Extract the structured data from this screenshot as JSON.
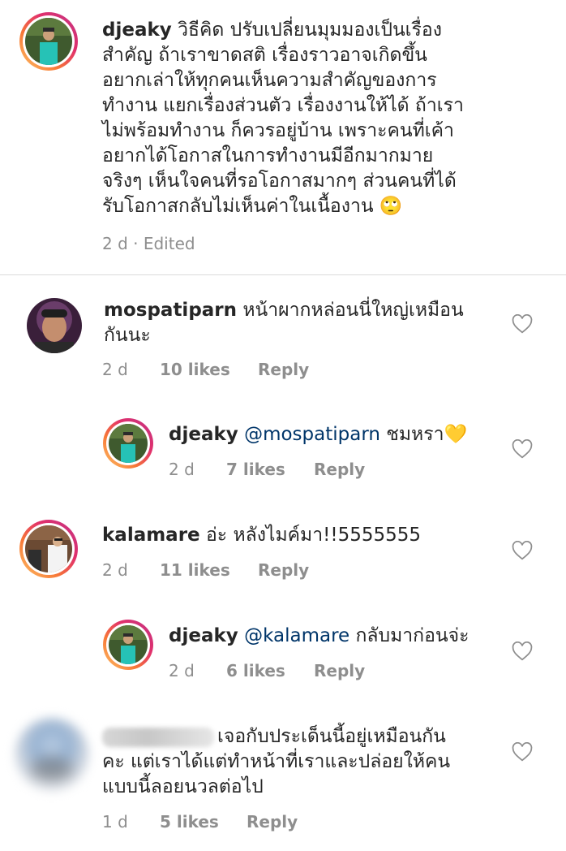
{
  "caption": {
    "username": "djeaky",
    "text": "วิธีคิด ปรับเปลี่ยนมุมมองเป็นเรื่องสำคัญ ถ้าเราขาดสติ เรื่องราวอาจเกิดขึ้น อยากเล่าให้ทุกคนเห็นความสำคัญของการทำงาน แยกเรื่องส่วนตัว เรื่องงานให้ได้ ถ้าเราไม่พร้อมทำงาน ก็ควรอยู่บ้าน เพราะคนที่เค้าอยากได้โอกาสในการทำงานมีอีกมากมาย จริงๆ เห็นใจคนที่รอโอกาสมากๆ ส่วนคนที่ได้รับโอกาสกลับไม่เห็นค่าในเนื้องาน 🙄",
    "lines": [
      "วิธีคิด ปรับเปลี่ยนมุมมองเป็นเรื่อง",
      "สำคัญ ถ้าเราขาดสติ เรื่องราวอาจเกิดขึ้น",
      "อยากเล่าให้ทุกคนเห็นความสำคัญของการ",
      "ทำงาน แยกเรื่องส่วนตัว เรื่องงานให้ได้ ถ้าเรา",
      "ไม่พร้อมทำงาน ก็ควรอยู่บ้าน เพราะคนที่เค้า",
      "อยากได้โอกาสในการทำงานมีอีกมากมาย",
      "จริงๆ เห็นใจคนที่รอโอกาสมากๆ ส่วนคนที่ได้",
      "รับโอกาสกลับไม่เห็นค่าในเนื้องาน 🙄"
    ],
    "meta": "2 d · Edited"
  },
  "comments": [
    {
      "username": "mospatiparn",
      "line1": "หน้าผากหล่อนนี่ใหญ่เหมือน",
      "line2": "กันนะ",
      "time": "2 d",
      "likes": "10 likes",
      "reply": "Reply"
    },
    {
      "username": "djeaky",
      "mention": "@mospatiparn",
      "text": "ชมหรา💛",
      "time": "2 d",
      "likes": "7 likes",
      "reply": "Reply"
    },
    {
      "username": "kalamare",
      "text": "อ่ะ หลังไมค์มา!!5555555",
      "time": "2 d",
      "likes": "11 likes",
      "reply": "Reply"
    },
    {
      "username": "djeaky",
      "mention": "@kalamare",
      "text": "กลับมาก่อนจ่ะ",
      "time": "2 d",
      "likes": "6 likes",
      "reply": "Reply"
    },
    {
      "line1": "เจอกับประเด็นนี้อยู่เหมือนกัน",
      "line2": "คะ แต่เราได้แต่ทำหน้าที่เราและปล่อยให้คน",
      "line3": "แบบนี้ลอยนวลต่อไป",
      "time": "1 d",
      "likes": "5 likes",
      "reply": "Reply"
    }
  ],
  "icons": {
    "like": "heart-outline-icon"
  },
  "colors": {
    "text": "#262626",
    "meta": "#8e8e8e",
    "mention": "#003569",
    "divider": "#dbdbdb",
    "story_ring": [
      "#fdc468",
      "#f77737",
      "#e1306c",
      "#c13584"
    ]
  }
}
